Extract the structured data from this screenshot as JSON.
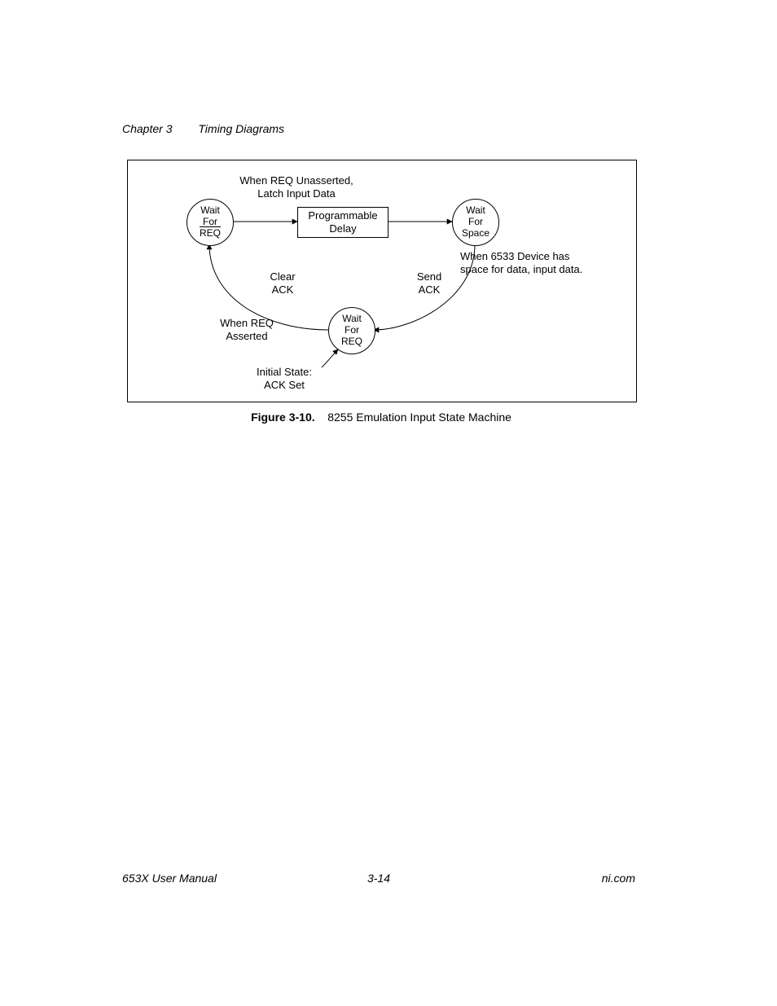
{
  "header": {
    "chapter": "Chapter 3",
    "title": "Timing Diagrams"
  },
  "caption": {
    "label": "Figure 3-10.",
    "text": "8255 Emulation Input State Machine"
  },
  "footer": {
    "left": "653X User Manual",
    "mid": "3-14",
    "right": "ni.com"
  },
  "diagram": {
    "state_wait_req_bar": {
      "l1": "Wait",
      "l2": "For",
      "l3": "REQ"
    },
    "proc_delay": {
      "l1": "Programmable",
      "l2": "Delay"
    },
    "state_wait_space": {
      "l1": "Wait",
      "l2": "For",
      "l3": "Space"
    },
    "state_wait_req": {
      "l1": "Wait",
      "l2": "For",
      "l3": "REQ"
    },
    "txt_when_unasserted": {
      "l1": "When REQ Unasserted,",
      "l2": "Latch Input Data"
    },
    "txt_clear_ack": {
      "l1": "Clear",
      "l2": "ACK"
    },
    "txt_send_ack": {
      "l1": "Send",
      "l2": "ACK"
    },
    "txt_when_asserted": {
      "l1": "When REQ",
      "l2": "Asserted"
    },
    "txt_when_space": {
      "l1": "When 6533 Device has",
      "l2": "space for data, input data."
    },
    "txt_initial": {
      "l1": "Initial State:",
      "l2": "ACK Set"
    }
  }
}
